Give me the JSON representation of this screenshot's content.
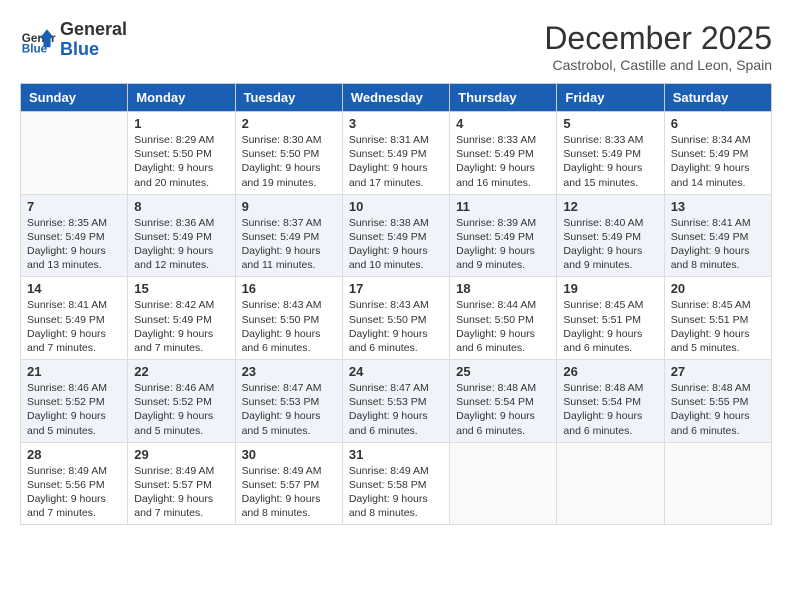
{
  "logo": {
    "line1": "General",
    "line2": "Blue"
  },
  "title": "December 2025",
  "location": "Castrobol, Castille and Leon, Spain",
  "days_header": [
    "Sunday",
    "Monday",
    "Tuesday",
    "Wednesday",
    "Thursday",
    "Friday",
    "Saturday"
  ],
  "weeks": [
    [
      {
        "num": "",
        "info": ""
      },
      {
        "num": "1",
        "info": "Sunrise: 8:29 AM\nSunset: 5:50 PM\nDaylight: 9 hours\nand 20 minutes."
      },
      {
        "num": "2",
        "info": "Sunrise: 8:30 AM\nSunset: 5:50 PM\nDaylight: 9 hours\nand 19 minutes."
      },
      {
        "num": "3",
        "info": "Sunrise: 8:31 AM\nSunset: 5:49 PM\nDaylight: 9 hours\nand 17 minutes."
      },
      {
        "num": "4",
        "info": "Sunrise: 8:33 AM\nSunset: 5:49 PM\nDaylight: 9 hours\nand 16 minutes."
      },
      {
        "num": "5",
        "info": "Sunrise: 8:33 AM\nSunset: 5:49 PM\nDaylight: 9 hours\nand 15 minutes."
      },
      {
        "num": "6",
        "info": "Sunrise: 8:34 AM\nSunset: 5:49 PM\nDaylight: 9 hours\nand 14 minutes."
      }
    ],
    [
      {
        "num": "7",
        "info": "Sunrise: 8:35 AM\nSunset: 5:49 PM\nDaylight: 9 hours\nand 13 minutes."
      },
      {
        "num": "8",
        "info": "Sunrise: 8:36 AM\nSunset: 5:49 PM\nDaylight: 9 hours\nand 12 minutes."
      },
      {
        "num": "9",
        "info": "Sunrise: 8:37 AM\nSunset: 5:49 PM\nDaylight: 9 hours\nand 11 minutes."
      },
      {
        "num": "10",
        "info": "Sunrise: 8:38 AM\nSunset: 5:49 PM\nDaylight: 9 hours\nand 10 minutes."
      },
      {
        "num": "11",
        "info": "Sunrise: 8:39 AM\nSunset: 5:49 PM\nDaylight: 9 hours\nand 9 minutes."
      },
      {
        "num": "12",
        "info": "Sunrise: 8:40 AM\nSunset: 5:49 PM\nDaylight: 9 hours\nand 9 minutes."
      },
      {
        "num": "13",
        "info": "Sunrise: 8:41 AM\nSunset: 5:49 PM\nDaylight: 9 hours\nand 8 minutes."
      }
    ],
    [
      {
        "num": "14",
        "info": "Sunrise: 8:41 AM\nSunset: 5:49 PM\nDaylight: 9 hours\nand 7 minutes."
      },
      {
        "num": "15",
        "info": "Sunrise: 8:42 AM\nSunset: 5:49 PM\nDaylight: 9 hours\nand 7 minutes."
      },
      {
        "num": "16",
        "info": "Sunrise: 8:43 AM\nSunset: 5:50 PM\nDaylight: 9 hours\nand 6 minutes."
      },
      {
        "num": "17",
        "info": "Sunrise: 8:43 AM\nSunset: 5:50 PM\nDaylight: 9 hours\nand 6 minutes."
      },
      {
        "num": "18",
        "info": "Sunrise: 8:44 AM\nSunset: 5:50 PM\nDaylight: 9 hours\nand 6 minutes."
      },
      {
        "num": "19",
        "info": "Sunrise: 8:45 AM\nSunset: 5:51 PM\nDaylight: 9 hours\nand 6 minutes."
      },
      {
        "num": "20",
        "info": "Sunrise: 8:45 AM\nSunset: 5:51 PM\nDaylight: 9 hours\nand 5 minutes."
      }
    ],
    [
      {
        "num": "21",
        "info": "Sunrise: 8:46 AM\nSunset: 5:52 PM\nDaylight: 9 hours\nand 5 minutes."
      },
      {
        "num": "22",
        "info": "Sunrise: 8:46 AM\nSunset: 5:52 PM\nDaylight: 9 hours\nand 5 minutes."
      },
      {
        "num": "23",
        "info": "Sunrise: 8:47 AM\nSunset: 5:53 PM\nDaylight: 9 hours\nand 5 minutes."
      },
      {
        "num": "24",
        "info": "Sunrise: 8:47 AM\nSunset: 5:53 PM\nDaylight: 9 hours\nand 6 minutes."
      },
      {
        "num": "25",
        "info": "Sunrise: 8:48 AM\nSunset: 5:54 PM\nDaylight: 9 hours\nand 6 minutes."
      },
      {
        "num": "26",
        "info": "Sunrise: 8:48 AM\nSunset: 5:54 PM\nDaylight: 9 hours\nand 6 minutes."
      },
      {
        "num": "27",
        "info": "Sunrise: 8:48 AM\nSunset: 5:55 PM\nDaylight: 9 hours\nand 6 minutes."
      }
    ],
    [
      {
        "num": "28",
        "info": "Sunrise: 8:49 AM\nSunset: 5:56 PM\nDaylight: 9 hours\nand 7 minutes."
      },
      {
        "num": "29",
        "info": "Sunrise: 8:49 AM\nSunset: 5:57 PM\nDaylight: 9 hours\nand 7 minutes."
      },
      {
        "num": "30",
        "info": "Sunrise: 8:49 AM\nSunset: 5:57 PM\nDaylight: 9 hours\nand 8 minutes."
      },
      {
        "num": "31",
        "info": "Sunrise: 8:49 AM\nSunset: 5:58 PM\nDaylight: 9 hours\nand 8 minutes."
      },
      {
        "num": "",
        "info": ""
      },
      {
        "num": "",
        "info": ""
      },
      {
        "num": "",
        "info": ""
      }
    ]
  ]
}
